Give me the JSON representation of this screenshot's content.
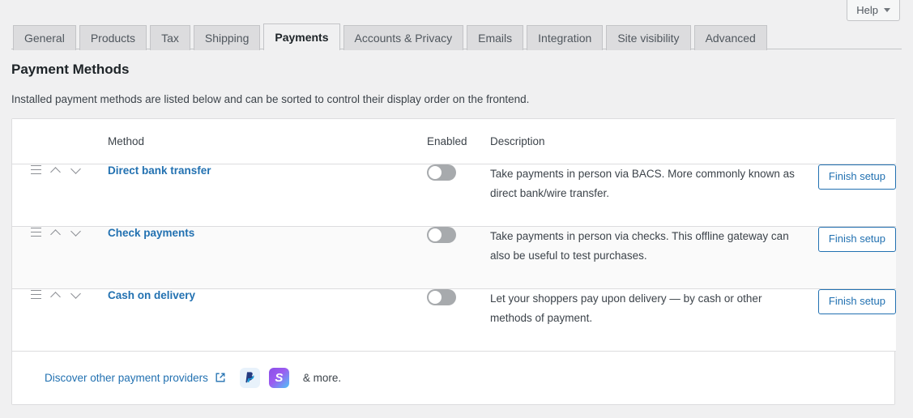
{
  "help": {
    "label": "Help",
    "caret_icon": "chevron-down-icon"
  },
  "tabs": [
    {
      "label": "General",
      "active": false
    },
    {
      "label": "Products",
      "active": false
    },
    {
      "label": "Tax",
      "active": false
    },
    {
      "label": "Shipping",
      "active": false
    },
    {
      "label": "Payments",
      "active": true
    },
    {
      "label": "Accounts & Privacy",
      "active": false
    },
    {
      "label": "Emails",
      "active": false
    },
    {
      "label": "Integration",
      "active": false
    },
    {
      "label": "Site visibility",
      "active": false
    },
    {
      "label": "Advanced",
      "active": false
    }
  ],
  "page": {
    "title": "Payment Methods",
    "description": "Installed payment methods are listed below and can be sorted to control their display order on the frontend."
  },
  "table": {
    "headers": {
      "sort": "",
      "method": "Method",
      "enabled": "Enabled",
      "description": "Description",
      "action": ""
    },
    "rows": [
      {
        "drag_icon": "drag-handle-icon",
        "up_icon": "chevron-up-icon",
        "down_icon": "chevron-down-icon",
        "name": "Direct bank transfer",
        "enabled": false,
        "description": "Take payments in person via BACS. More commonly known as direct bank/wire transfer.",
        "action_label": "Finish setup"
      },
      {
        "drag_icon": "drag-handle-icon",
        "up_icon": "chevron-up-icon",
        "down_icon": "chevron-down-icon",
        "name": "Check payments",
        "enabled": false,
        "description": "Take payments in person via checks. This offline gateway can also be useful to test purchases.",
        "action_label": "Finish setup"
      },
      {
        "drag_icon": "drag-handle-icon",
        "up_icon": "chevron-up-icon",
        "down_icon": "chevron-down-icon",
        "name": "Cash on delivery",
        "enabled": false,
        "description": "Let your shoppers pay upon delivery — by cash or other methods of payment.",
        "action_label": "Finish setup"
      }
    ]
  },
  "footer": {
    "discover_label": "Discover other payment providers",
    "external_icon": "external-link-icon",
    "providers": [
      {
        "name": "paypal-icon",
        "letter": "P"
      },
      {
        "name": "stripe-icon",
        "letter": "S"
      }
    ],
    "more_text": "& more."
  },
  "colors": {
    "accent": "#2271b1",
    "page_bg": "#f0f0f1",
    "card_bg": "#ffffff",
    "border": "#dcdcde",
    "toggle_off": "#a7aaad",
    "tab_bg": "#dcdcde"
  }
}
